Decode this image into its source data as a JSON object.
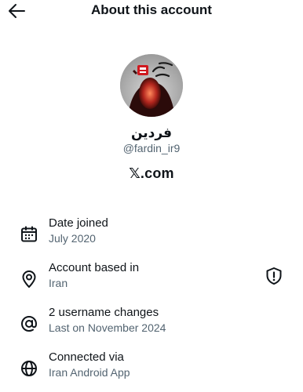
{
  "header": {
    "title": "About this account",
    "back_icon": "arrow-left-icon"
  },
  "profile": {
    "display_name": "فردین",
    "handle": "@fardin_ir9",
    "domain": "𝕏.com",
    "avatar_icon": "profile-avatar",
    "avatar_text": "تا ابد پرسپولیس"
  },
  "details": [
    {
      "icon": "calendar-icon",
      "label": "Date joined",
      "value": "July 2020"
    },
    {
      "icon": "location-pin-icon",
      "label": "Account based in",
      "value": "Iran"
    },
    {
      "icon": "at-sign-icon",
      "label": "2 username changes",
      "value": "Last on November 2024"
    },
    {
      "icon": "globe-icon",
      "label": "Connected via",
      "value": "Iran Android App"
    }
  ],
  "colors": {
    "text": "#0f1419",
    "muted": "#536471",
    "background": "#ffffff",
    "logo_red": "#d0191f"
  }
}
